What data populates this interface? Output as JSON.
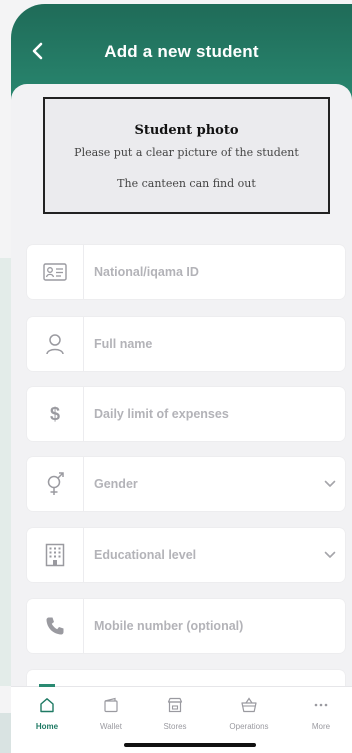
{
  "header": {
    "title": "Add a new student"
  },
  "photo": {
    "title": "Student photo",
    "subtitle": "Please put a clear picture of the student",
    "note": "The canteen can find out"
  },
  "fields": [
    {
      "name": "national-id",
      "label": "National/iqama ID",
      "icon": "id-card-icon",
      "dropdown": false
    },
    {
      "name": "full-name",
      "label": "Full name",
      "icon": "person-icon",
      "dropdown": false
    },
    {
      "name": "daily-limit",
      "label": "Daily limit of expenses",
      "icon": "dollar-icon",
      "dropdown": false
    },
    {
      "name": "gender",
      "label": "Gender",
      "icon": "gender-icon",
      "dropdown": true
    },
    {
      "name": "educational-level",
      "label": "Educational level",
      "icon": "building-icon",
      "dropdown": true
    },
    {
      "name": "mobile-number",
      "label": "Mobile number (optional)",
      "icon": "phone-icon",
      "dropdown": false
    }
  ],
  "tabs": [
    {
      "label": "Home",
      "icon": "home-icon",
      "active": true
    },
    {
      "label": "Wallet",
      "icon": "wallet-icon",
      "active": false
    },
    {
      "label": "Stores",
      "icon": "store-icon",
      "active": false
    },
    {
      "label": "Operations",
      "icon": "basket-icon",
      "active": false
    },
    {
      "label": "More",
      "icon": "more-icon",
      "active": false
    }
  ],
  "colors": {
    "primary": "#1f6b58",
    "accent": "#2a8a72",
    "placeholder": "#b3b3b8",
    "icon": "#9a9aa0"
  }
}
